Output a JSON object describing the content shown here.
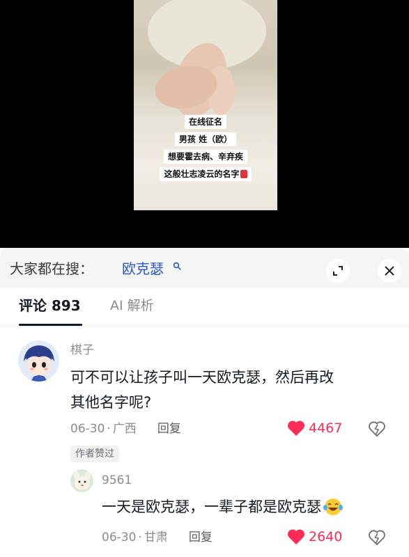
{
  "video": {
    "caption_lines": [
      "在线征名",
      "男孩 姓（欧）",
      "想要霍去病、辛弃疾",
      "这般壮志凌云的名字"
    ],
    "caption_emoji": "red-envelope-emoji"
  },
  "search": {
    "prefix": "大家都在搜：",
    "term": "欧克瑟"
  },
  "tabs": {
    "comments": "评论 893",
    "ai": "AI 解析"
  },
  "comments": [
    {
      "user": "棋子",
      "text_line1": "可不可以让孩子叫一天欧克瑟，然后再改",
      "text_line2": "其他名字呢?",
      "date": "06-30",
      "location": "广西",
      "reply_label": "回复",
      "likes": "4467",
      "badge": "作者赞过",
      "avatar": "anime-boy-avatar"
    },
    {
      "user": "9561",
      "text": "一天是欧克瑟，一辈子都是欧克瑟",
      "emoji": "laughing-tears-emoji",
      "date": "06-30",
      "location": "甘肃",
      "reply_label": "回复",
      "likes": "2640",
      "avatar": "cartoon-animal-avatar"
    }
  ],
  "colors": {
    "search_term": "#2a56c6",
    "like": "#fe2c55",
    "muted": "#8a8b91"
  }
}
